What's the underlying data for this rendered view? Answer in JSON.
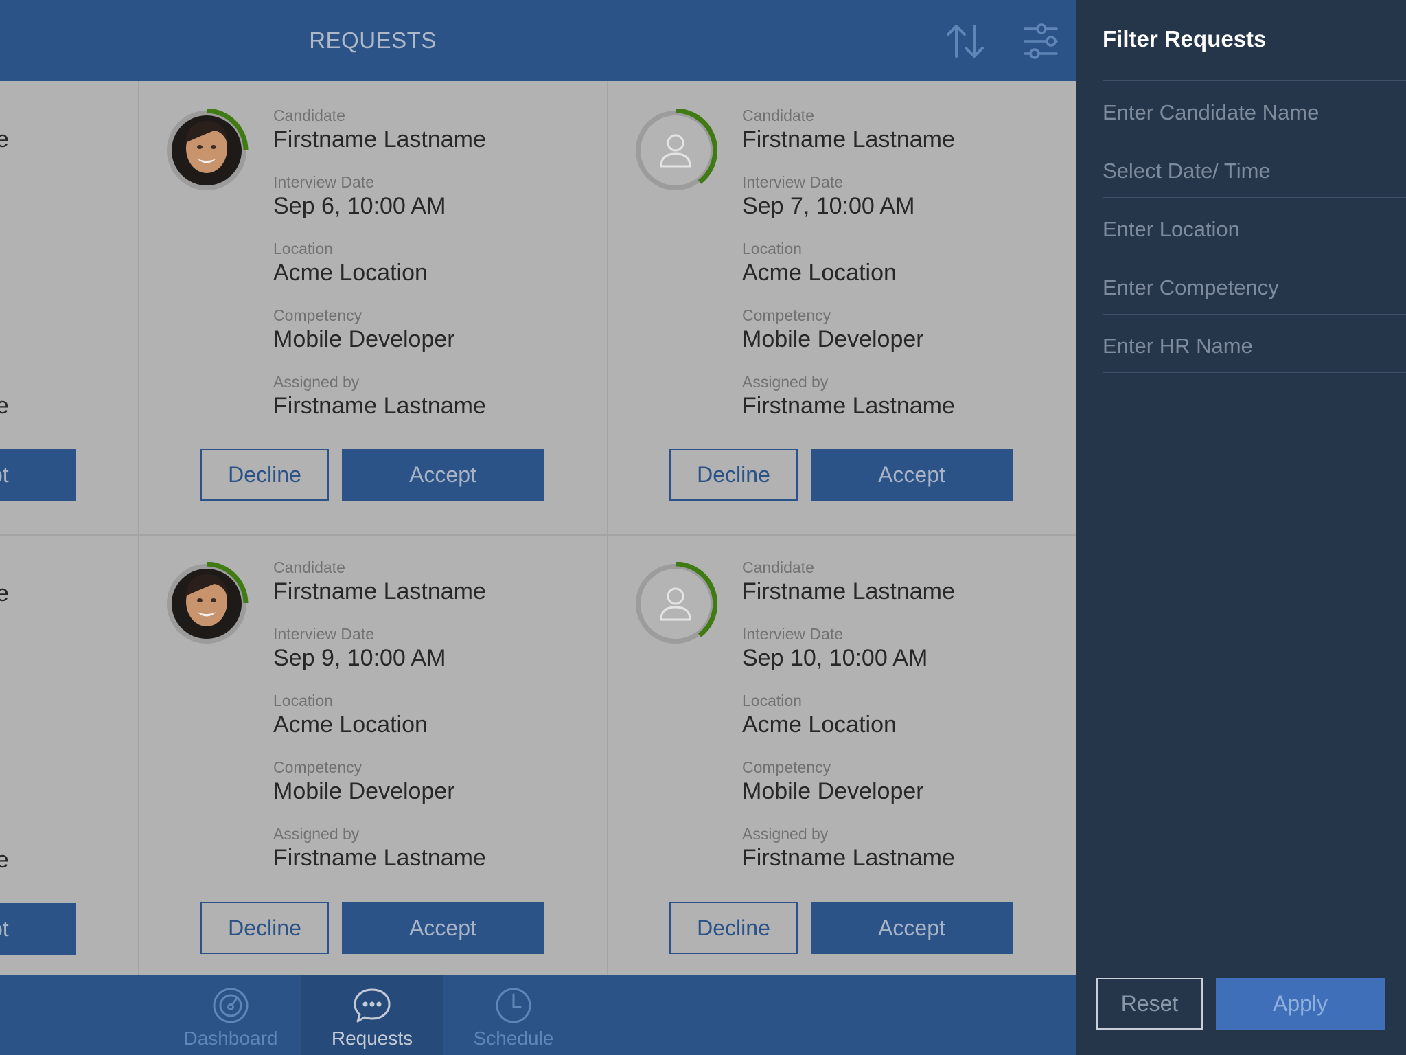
{
  "header": {
    "title": "REQUESTS",
    "sort_icon": "sort-arrows-icon",
    "filter_icon": "sliders-icon"
  },
  "partial_column": {
    "values": [
      "e",
      "e",
      "e",
      "e"
    ],
    "accept_label": "ot"
  },
  "labels": {
    "candidate": "Candidate",
    "interview_date": "Interview Date",
    "location": "Location",
    "competency": "Competency",
    "assigned_by": "Assigned by",
    "decline": "Decline",
    "accept": "Accept"
  },
  "cards": [
    {
      "avatar": "photo",
      "candidate": "Firstname Lastname",
      "interview_date": "Sep 6,  10:00 AM",
      "location": "Acme Location",
      "competency": "Mobile Developer",
      "assigned_by": "Firstname Lastname"
    },
    {
      "avatar": "placeholder",
      "candidate": "Firstname Lastname",
      "interview_date": "Sep 7,  10:00 AM",
      "location": "Acme Location",
      "competency": "Mobile Developer",
      "assigned_by": "Firstname Lastname"
    },
    {
      "avatar": "photo",
      "candidate": "Firstname Lastname",
      "interview_date": "Sep 9,  10:00 AM",
      "location": "Acme Location",
      "competency": "Mobile Developer",
      "assigned_by": "Firstname Lastname"
    },
    {
      "avatar": "placeholder",
      "candidate": "Firstname Lastname",
      "interview_date": "Sep 10,  10:00 AM",
      "location": "Acme Location",
      "competency": "Mobile Developer",
      "assigned_by": "Firstname Lastname"
    }
  ],
  "tabbar": {
    "tabs": [
      {
        "label": "Dashboard",
        "icon": "dashboard-gauge-icon",
        "active": false
      },
      {
        "label": "Requests",
        "icon": "chat-bubble-icon",
        "active": true
      },
      {
        "label": "Schedule",
        "icon": "clock-icon",
        "active": false
      }
    ]
  },
  "filter_panel": {
    "title": "Filter Requests",
    "fields": [
      {
        "placeholder": "Enter Candidate Name",
        "value": ""
      },
      {
        "placeholder": "Select Date/ Time",
        "value": ""
      },
      {
        "placeholder": "Enter Location",
        "value": ""
      },
      {
        "placeholder": "Enter Competency",
        "value": ""
      },
      {
        "placeholder": "Enter HR Name",
        "value": ""
      }
    ],
    "reset_label": "Reset",
    "apply_label": "Apply"
  },
  "colors": {
    "brand_blue": "#2c5388",
    "panel_bg": "#26364a",
    "apply_blue": "#3e6fb8",
    "progress_green": "#3f7a12"
  }
}
